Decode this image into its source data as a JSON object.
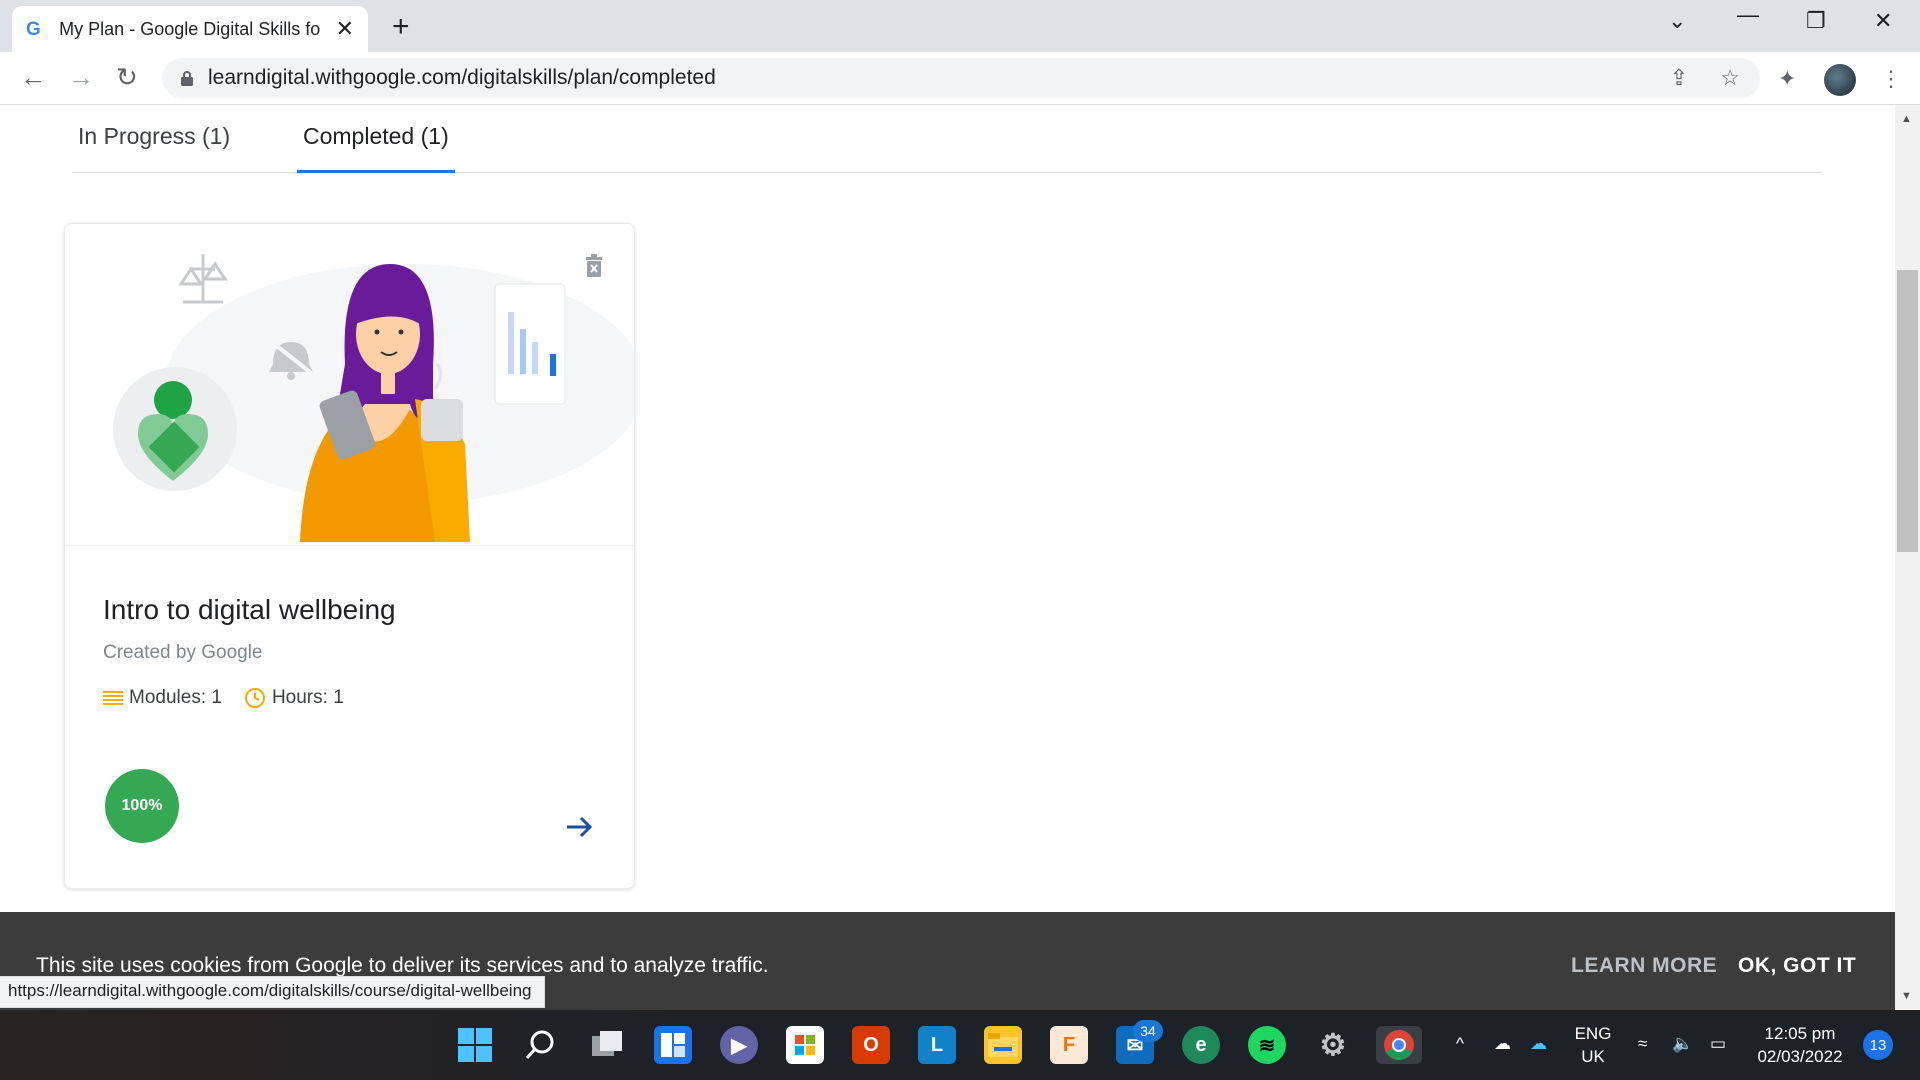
{
  "browser": {
    "tab_title": "My Plan - Google Digital Skills fo",
    "url": "learndigital.withgoogle.com/digitalskills/plan/completed",
    "status_url": "https://learndigital.withgoogle.com/digitalskills/course/digital-wellbeing"
  },
  "plan": {
    "tabs": [
      {
        "label": "In Progress (1)",
        "active": false
      },
      {
        "label": "Completed (1)",
        "active": true
      }
    ],
    "course": {
      "title": "Intro to digital wellbeing",
      "author": "Created by Google",
      "modules": "Modules: 1",
      "hours": "Hours: 1",
      "progress_label": "100%",
      "progress": 1.0
    }
  },
  "cookie_banner": {
    "text": "This site uses cookies from Google to deliver its services and to analyze traffic.",
    "learn_more": "LEARN MORE",
    "ok": "OK, GOT IT"
  },
  "taskbar": {
    "mail_badge": "34",
    "language": "ENG",
    "region": "UK",
    "time": "12:05 pm",
    "date": "02/03/2022",
    "notifications": "13"
  },
  "colors": {
    "accent": "#1a73e8",
    "progress": "#34a853",
    "cookie_bg": "#3c3c3c"
  }
}
